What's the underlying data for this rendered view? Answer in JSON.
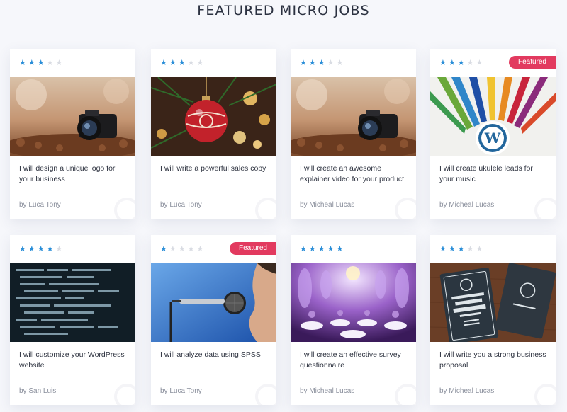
{
  "section_title": "FEATURED MICRO JOBS",
  "colors": {
    "accent": "#2a8ed8",
    "badge": "#e23a5f",
    "star_off": "#d9dce3"
  },
  "jobs": [
    {
      "title": "I will design a unique logo for your business",
      "author_prefix": "by",
      "author": "Luca Tony",
      "rating": 3,
      "featured": false,
      "image": "camera-on-leaves"
    },
    {
      "title": "I will write a powerful sales copy",
      "author_prefix": "by",
      "author": "Luca Tony",
      "rating": 3,
      "featured": false,
      "image": "christmas-ornament"
    },
    {
      "title": "I will create an awesome explainer video for your product",
      "author_prefix": "by",
      "author": "Micheal Lucas",
      "rating": 3,
      "featured": false,
      "image": "camera-on-leaves"
    },
    {
      "title": "I will create ukulele leads for your music",
      "author_prefix": "by",
      "author": "Micheal Lucas",
      "rating": 3,
      "featured": true,
      "badge": "Featured",
      "image": "pencils-wordpress"
    },
    {
      "title": "I will customize your WordPress website",
      "author_prefix": "by",
      "author": "San Luis",
      "rating": 4,
      "featured": false,
      "image": "code-screen"
    },
    {
      "title": "I will analyze data using SPSS",
      "author_prefix": "by",
      "author": "Luca Tony",
      "rating": 1,
      "featured": true,
      "badge": "Featured",
      "image": "singer-microphone"
    },
    {
      "title": "I will create an effective survey questionnaire",
      "author_prefix": "by",
      "author": "Micheal Lucas",
      "rating": 5,
      "featured": false,
      "image": "event-hall"
    },
    {
      "title": "I will write you a strong business proposal",
      "author_prefix": "by",
      "author": "Micheal Lucas",
      "rating": 3,
      "featured": false,
      "image": "business-cards"
    }
  ]
}
